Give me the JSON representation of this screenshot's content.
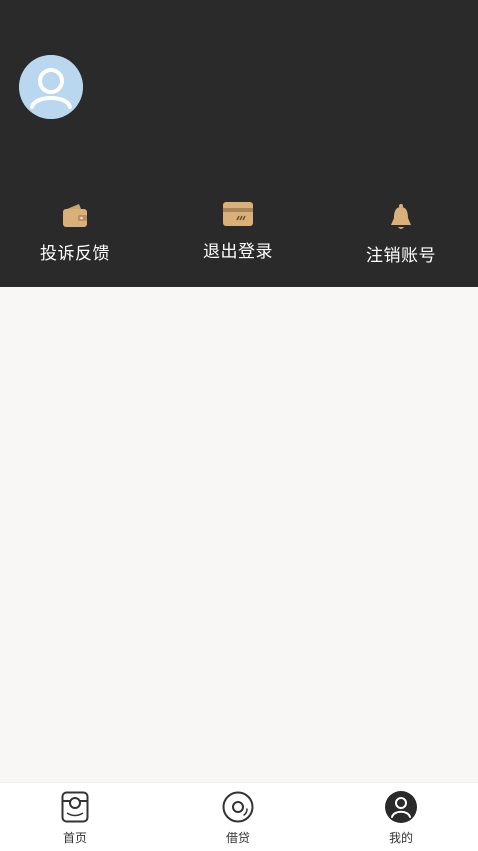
{
  "profile": {
    "avatar_icon": "user-avatar-icon"
  },
  "actions": [
    {
      "label": "投诉反馈",
      "icon": "wallet-icon"
    },
    {
      "label": "退出登录",
      "icon": "card-icon"
    },
    {
      "label": "注销账号",
      "icon": "bell-icon"
    }
  ],
  "tabs": [
    {
      "label": "首页",
      "icon": "home-icon"
    },
    {
      "label": "借贷",
      "icon": "loan-disc-icon"
    },
    {
      "label": "我的",
      "icon": "profile-icon",
      "active": true
    }
  ],
  "colors": {
    "header_bg": "#2a2a2a",
    "accent_gold": "#d9b07a",
    "avatar_bg": "#b9d7ee",
    "page_bg": "#f8f7f5"
  }
}
